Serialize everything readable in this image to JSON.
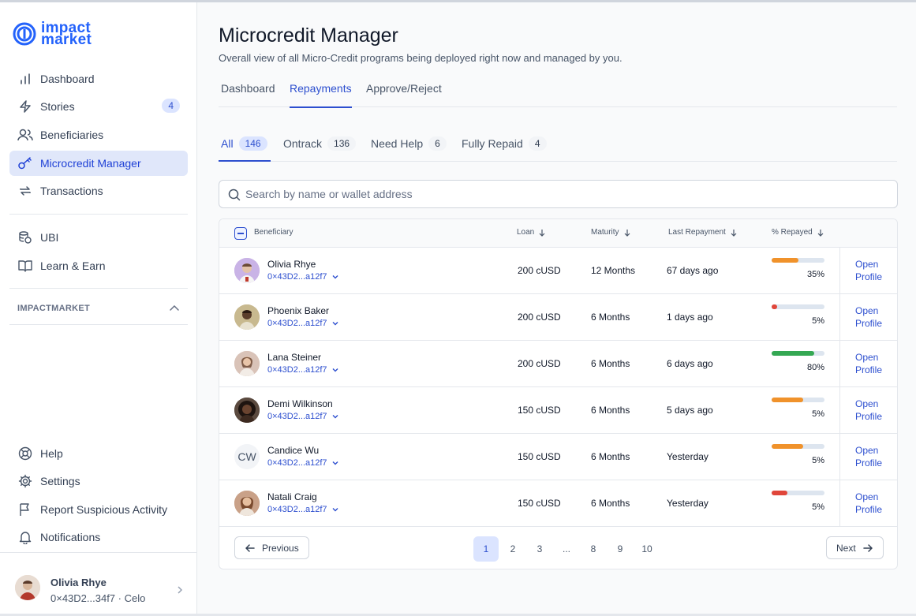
{
  "logo": {
    "line1": "impact",
    "line2": "market"
  },
  "sidebar": {
    "items": [
      {
        "label": "Dashboard",
        "icon": "bar-chart-icon"
      },
      {
        "label": "Stories",
        "icon": "lightning-icon",
        "badge": "4"
      },
      {
        "label": "Beneficiaries",
        "icon": "users-icon"
      },
      {
        "label": "Microcredit Manager",
        "icon": "key-icon",
        "active": true
      },
      {
        "label": "Transactions",
        "icon": "arrows-swap-icon"
      }
    ],
    "items2": [
      {
        "label": "UBI",
        "icon": "coins-stack-icon"
      },
      {
        "label": "Learn & Earn",
        "icon": "book-open-icon"
      }
    ],
    "section_label": "IMPACTMARKET",
    "bottom_items": [
      {
        "label": "Help",
        "icon": "life-buoy-icon"
      },
      {
        "label": "Settings",
        "icon": "gear-icon"
      },
      {
        "label": "Report Suspicious Activity",
        "icon": "flag-icon"
      },
      {
        "label": "Notifications",
        "icon": "bell-icon"
      }
    ],
    "user": {
      "name": "Olivia Rhye",
      "wallet": "0×43D2...34f7 · Celo"
    }
  },
  "header": {
    "title": "Microcredit Manager",
    "subtitle": "Overall view of all Micro-Credit programs being deployed right now and managed by you."
  },
  "top_tabs": [
    {
      "label": "Dashboard"
    },
    {
      "label": "Repayments",
      "active": true
    },
    {
      "label": "Approve/Reject"
    }
  ],
  "filter_tabs": [
    {
      "label": "All",
      "count": "146",
      "active": true
    },
    {
      "label": "Ontrack",
      "count": "136"
    },
    {
      "label": "Need Help",
      "count": "6"
    },
    {
      "label": "Fully Repaid",
      "count": "4"
    }
  ],
  "search": {
    "placeholder": "Search by name or wallet address"
  },
  "table": {
    "headers": {
      "beneficiary": "Beneficiary",
      "loan": "Loan",
      "maturity": "Maturity",
      "last_repayment": "Last Repayment",
      "repaid": "% Repayed"
    },
    "open_label": "Open Profile",
    "rows": [
      {
        "name": "Olivia Rhye",
        "wallet": "0×43D2...a12f7",
        "loan": "200 cUSD",
        "maturity": "12 Months",
        "last": "67 days ago",
        "pct": "35%",
        "fill": 0.5,
        "color": "#f0922b",
        "avatar_bg": "#c9b3e6",
        "initials": ""
      },
      {
        "name": "Phoenix Baker",
        "wallet": "0×43D2...a12f7",
        "loan": "200 cUSD",
        "maturity": "6 Months",
        "last": "1 days ago",
        "pct": "5%",
        "fill": 0.1,
        "color": "#e0463a",
        "avatar_bg": "#c8b98f",
        "initials": ""
      },
      {
        "name": "Lana Steiner",
        "wallet": "0×43D2...a12f7",
        "loan": "200 cUSD",
        "maturity": "6 Months",
        "last": "6 days ago",
        "pct": "80%",
        "fill": 0.8,
        "color": "#34a853",
        "avatar_bg": "#d9c3b8",
        "initials": ""
      },
      {
        "name": "Demi Wilkinson",
        "wallet": "0×43D2...a12f7",
        "loan": "150 cUSD",
        "maturity": "6 Months",
        "last": "5 days ago",
        "pct": "5%",
        "fill": 0.6,
        "color": "#f0922b",
        "avatar_bg": "#5b4a3f",
        "initials": ""
      },
      {
        "name": "Candice Wu",
        "wallet": "0×43D2...a12f7",
        "loan": "150 cUSD",
        "maturity": "6 Months",
        "last": "Yesterday",
        "pct": "5%",
        "fill": 0.6,
        "color": "#f0922b",
        "avatar_bg": "#f2f4f7",
        "initials": "CW"
      },
      {
        "name": "Natali Craig",
        "wallet": "0×43D2...a12f7",
        "loan": "150 cUSD",
        "maturity": "6 Months",
        "last": "Yesterday",
        "pct": "5%",
        "fill": 0.3,
        "color": "#e0463a",
        "avatar_bg": "#c9a188",
        "initials": ""
      }
    ]
  },
  "pagination": {
    "previous": "Previous",
    "next": "Next",
    "pages": [
      "1",
      "2",
      "3",
      "...",
      "8",
      "9",
      "10"
    ],
    "current": "1"
  }
}
